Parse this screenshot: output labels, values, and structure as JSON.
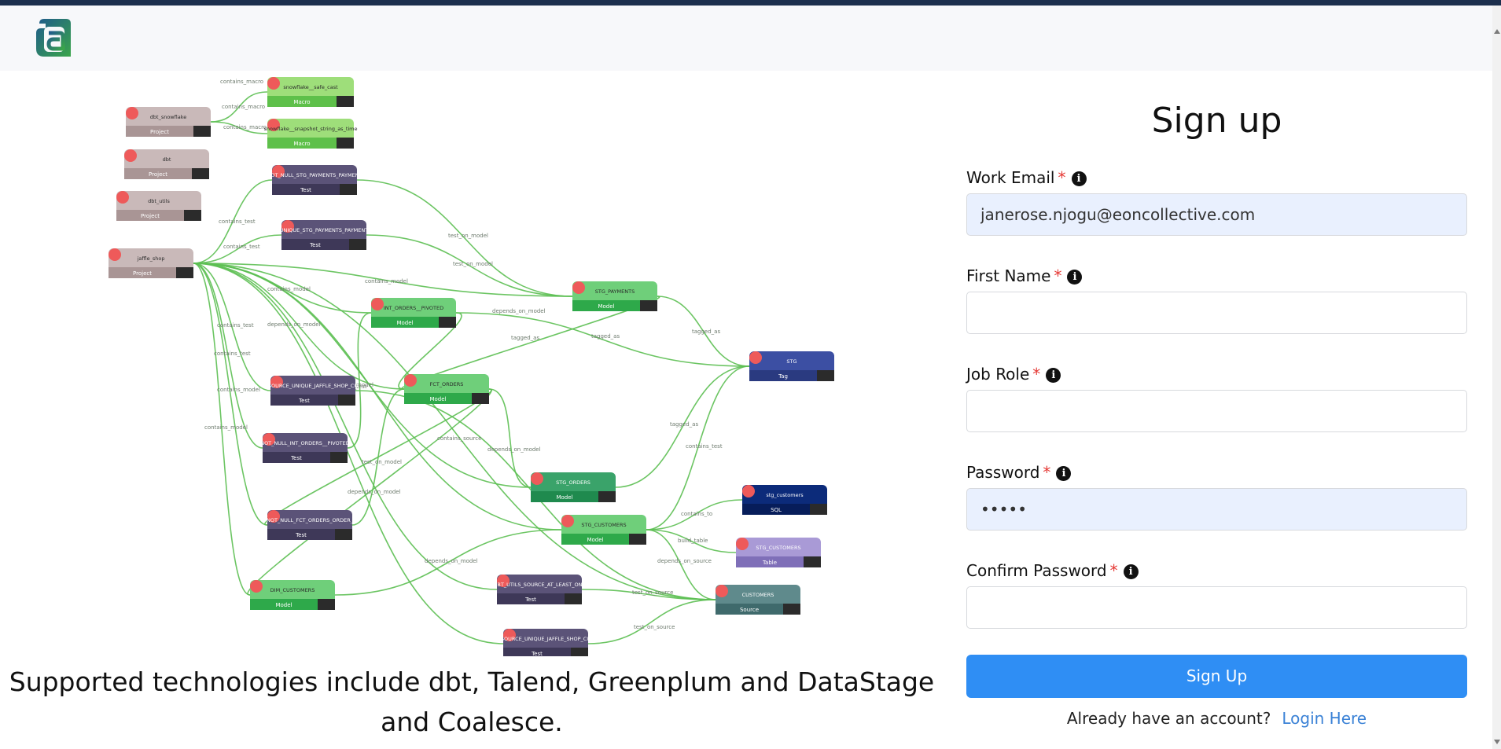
{
  "app": {
    "logo_icon": "brand-logo-icon"
  },
  "graph": {
    "nodes": [
      {
        "id": "n1",
        "label": "snowflake__safe_cast",
        "type": "Macro",
        "color": "#9ede7a",
        "typeColor": "#5ec04a"
      },
      {
        "id": "n2",
        "label": "snowflake__snapshot_string_as_time",
        "type": "Macro",
        "color": "#9ede7a",
        "typeColor": "#5ec04a"
      },
      {
        "id": "n3",
        "label": "dbt_snowflake",
        "type": "Project",
        "color": "#c9b9b9",
        "typeColor": "#a99595"
      },
      {
        "id": "n4",
        "label": "dbt",
        "type": "Project",
        "color": "#c9b9b9",
        "typeColor": "#a99595"
      },
      {
        "id": "n5",
        "label": "dbt_utils",
        "type": "Project",
        "color": "#c9b9b9",
        "typeColor": "#a99595"
      },
      {
        "id": "n6",
        "label": "jaffle_shop",
        "type": "Project",
        "color": "#c9b9b9",
        "typeColor": "#a99595"
      },
      {
        "id": "n7",
        "label": "NOT_NULL_STG_PAYMENTS_PAYMENT",
        "type": "Test",
        "color": "#5b5378",
        "typeColor": "#3e3858"
      },
      {
        "id": "n8",
        "label": "UNIQUE_STG_PAYMENTS_PAYMENT",
        "type": "Test",
        "color": "#5b5378",
        "typeColor": "#3e3858"
      },
      {
        "id": "n9",
        "label": "INT_ORDERS__PIVOTED",
        "type": "Model",
        "color": "#6fcf7a",
        "typeColor": "#2ea94a"
      },
      {
        "id": "n10",
        "label": "STG_PAYMENTS",
        "type": "Model",
        "color": "#6fcf7a",
        "typeColor": "#2ea94a"
      },
      {
        "id": "n11",
        "label": "STG",
        "type": "Tag",
        "color": "#3c4fa3",
        "typeColor": "#2a3a80"
      },
      {
        "id": "n12",
        "label": "SOURCE_UNIQUE_JAFFLE_SHOP_CU",
        "type": "Test",
        "color": "#5b5378",
        "typeColor": "#3e3858"
      },
      {
        "id": "n13",
        "label": "FCT_ORDERS",
        "type": "Model",
        "color": "#6fcf7a",
        "typeColor": "#2ea94a"
      },
      {
        "id": "n14",
        "label": "NOT_NULL_INT_ORDERS__PIVOTED",
        "type": "Test",
        "color": "#5b5378",
        "typeColor": "#3e3858"
      },
      {
        "id": "n15",
        "label": "STG_ORDERS",
        "type": "Model",
        "color": "#3aa36a",
        "typeColor": "#1f8a4e"
      },
      {
        "id": "n16",
        "label": "stg_customers",
        "type": "SQL",
        "color": "#0c2b7a",
        "typeColor": "#071d5a"
      },
      {
        "id": "n17",
        "label": "NOT_NULL_FCT_ORDERS_ORDER_",
        "type": "Test",
        "color": "#5b5378",
        "typeColor": "#3e3858"
      },
      {
        "id": "n18",
        "label": "STG_CUSTOMERS",
        "type": "Model",
        "color": "#6fcf7a",
        "typeColor": "#2ea94a"
      },
      {
        "id": "n19",
        "label": "STG_CUSTOMERS",
        "type": "Table",
        "color": "#a99ad6",
        "typeColor": "#7f6fb8"
      },
      {
        "id": "n20",
        "label": "DIM_CUSTOMERS",
        "type": "Model",
        "color": "#6fcf7a",
        "typeColor": "#2ea94a"
      },
      {
        "id": "n21",
        "label": "DBT_UTILS_SOURCE_AT_LEAST_ONE",
        "type": "Test",
        "color": "#5b5378",
        "typeColor": "#3e3858"
      },
      {
        "id": "n22",
        "label": "CUSTOMERS",
        "type": "Source",
        "color": "#5f8a8c",
        "typeColor": "#3f6a6c"
      },
      {
        "id": "n23",
        "label": "SOURCE_UNIQUE_JAFFLE_SHOP_CU",
        "type": "Test",
        "color": "#5b5378",
        "typeColor": "#3e3858"
      }
    ],
    "edge_labels": [
      "contains_macro",
      "contains_macro",
      "contains_macro",
      "contains_test",
      "contains_test",
      "test_on_model",
      "test_on_model",
      "contains_model",
      "contains_model",
      "depends_on_model",
      "depends_on_model",
      "tagged_as",
      "tagged_as",
      "tagged_as",
      "tagged_as",
      "contains_test",
      "contains_test",
      "contains_test",
      "contains_model",
      "contains_model",
      "contains_model",
      "contains_test",
      "contains_source",
      "depends_on_model",
      "test_on_model",
      "depends_on_model",
      "contains_to",
      "build_table",
      "depends_on_source",
      "depends_on_model",
      "test_on_source",
      "test_on_source"
    ]
  },
  "caption": "Supported technologies include dbt, Talend, Greenplum and DataStage and Coalesce.",
  "form": {
    "title": "Sign up",
    "required_mark": "*",
    "info_icon": "info-icon",
    "fields": {
      "email": {
        "label": "Work Email",
        "value": "janerose.njogu@eoncollective.com",
        "placeholder": ""
      },
      "first_name": {
        "label": "First Name",
        "value": "",
        "placeholder": ""
      },
      "job_role": {
        "label": "Job Role",
        "value": "",
        "placeholder": ""
      },
      "password": {
        "label": "Password",
        "value": "•••••",
        "placeholder": ""
      },
      "confirm_password": {
        "label": "Confirm Password",
        "value": "",
        "placeholder": ""
      }
    },
    "submit_label": "Sign Up",
    "login_prompt": "Already have an account?",
    "login_link": "Login Here"
  },
  "colors": {
    "accent": "#2f8ef4",
    "link": "#3b82d6",
    "required": "#e53935",
    "edge": "#5cbf52",
    "header_strip": "#1c2f4d"
  }
}
